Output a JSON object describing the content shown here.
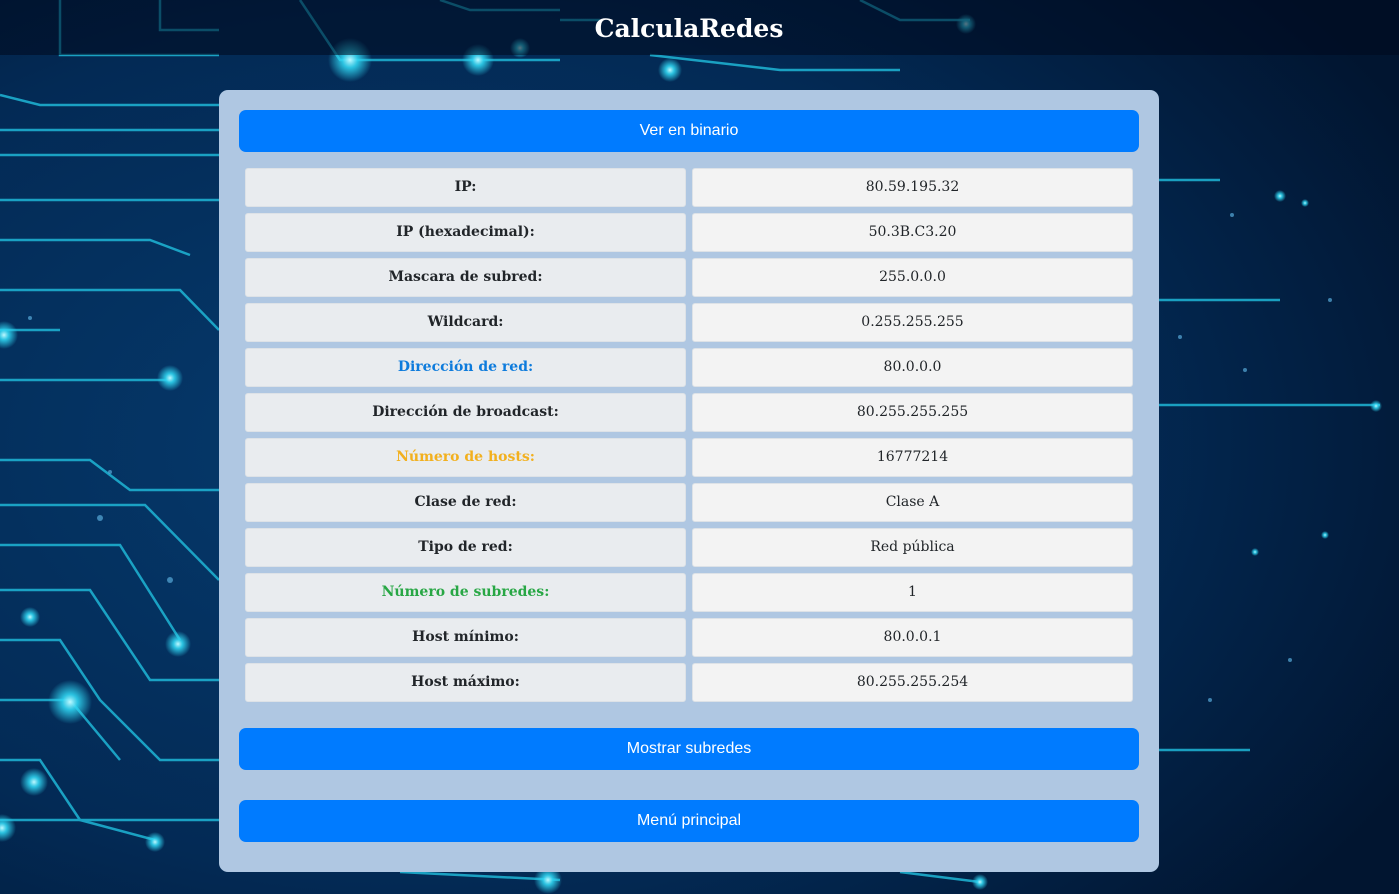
{
  "header": {
    "title": "CalculaRedes"
  },
  "buttons": {
    "binary": "Ver en binario",
    "subnets": "Mostrar subredes",
    "menu": "Menú principal"
  },
  "colors": {
    "primary": "#007bff",
    "panel": "#afc7e2",
    "network_highlight": "#0d7bdc",
    "hosts_highlight": "#f2b01e",
    "subnets_highlight": "#28a745"
  },
  "rows": [
    {
      "label": "IP:",
      "value": "80.59.195.32"
    },
    {
      "label": "IP (hexadecimal):",
      "value": "50.3B.C3.20"
    },
    {
      "label": "Mascara de subred:",
      "value": "255.0.0.0"
    },
    {
      "label": "Wildcard:",
      "value": "0.255.255.255"
    },
    {
      "label": "Dirección de red:",
      "value": "80.0.0.0",
      "color": "#0d7bdc"
    },
    {
      "label": "Dirección de broadcast:",
      "value": "80.255.255.255"
    },
    {
      "label": "Número de hosts:",
      "value": "16777214",
      "color": "#f2b01e"
    },
    {
      "label": "Clase de red:",
      "value": "Clase A"
    },
    {
      "label": "Tipo de red:",
      "value": "Red pública"
    },
    {
      "label": "Número de subredes:",
      "value": "1",
      "color": "#28a745"
    },
    {
      "label": "Host mínimo:",
      "value": "80.0.0.1"
    },
    {
      "label": "Host máximo:",
      "value": "80.255.255.254"
    }
  ]
}
